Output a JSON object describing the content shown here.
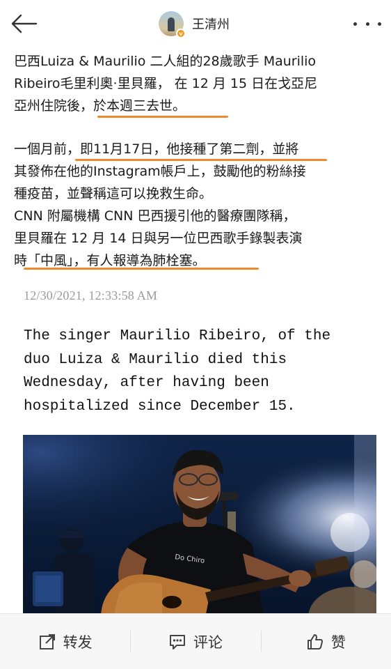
{
  "header": {
    "username": "王清州",
    "back_icon": "back-arrow-icon",
    "more_icon": "more-dots-icon",
    "verified_badge": "v"
  },
  "article": {
    "para1_line1": "巴西Luiza & Maurilio 二人組的28歲歌手 Maurilio",
    "para1_line2": "Ribeiro毛里利奧·里貝羅， 在 12 月 15 日在戈亞尼",
    "para1_line3": "亞州住院後，於本週三去世。",
    "para2_line1": " 一個月前，即11月17日，他接種了第二劑，並將",
    "para2_line2": "其發佈在他的Instagram帳戶上，鼓勵他的粉絲接",
    "para2_line3": "種疫苗，並聲稱這可以挽救生命。",
    "para2_line4": " CNN 附屬機構 CNN 巴西援引他的醫療團隊稱，",
    "para2_line5": "里貝羅在 12 月 14 日與另一位巴西歌手錄製表演",
    "para2_line6": "時「中風」，有人報導為肺栓塞。",
    "highlight_color": "#ee8a2e"
  },
  "screenshot": {
    "timestamp": "12/30/2021, 12:33:58 AM",
    "english_text": "The singer Maurilio Ribeiro, of the\nduo Luiza & Maurilio died this\nWednesday, after having been\nhospitalized since December 15.",
    "shirt_text": "Do Chiro"
  },
  "actions": {
    "repost_label": "转发",
    "comment_label": "评论",
    "like_label": "赞",
    "repost_icon": "share-icon",
    "comment_icon": "comment-icon",
    "like_icon": "thumbs-up-icon"
  }
}
